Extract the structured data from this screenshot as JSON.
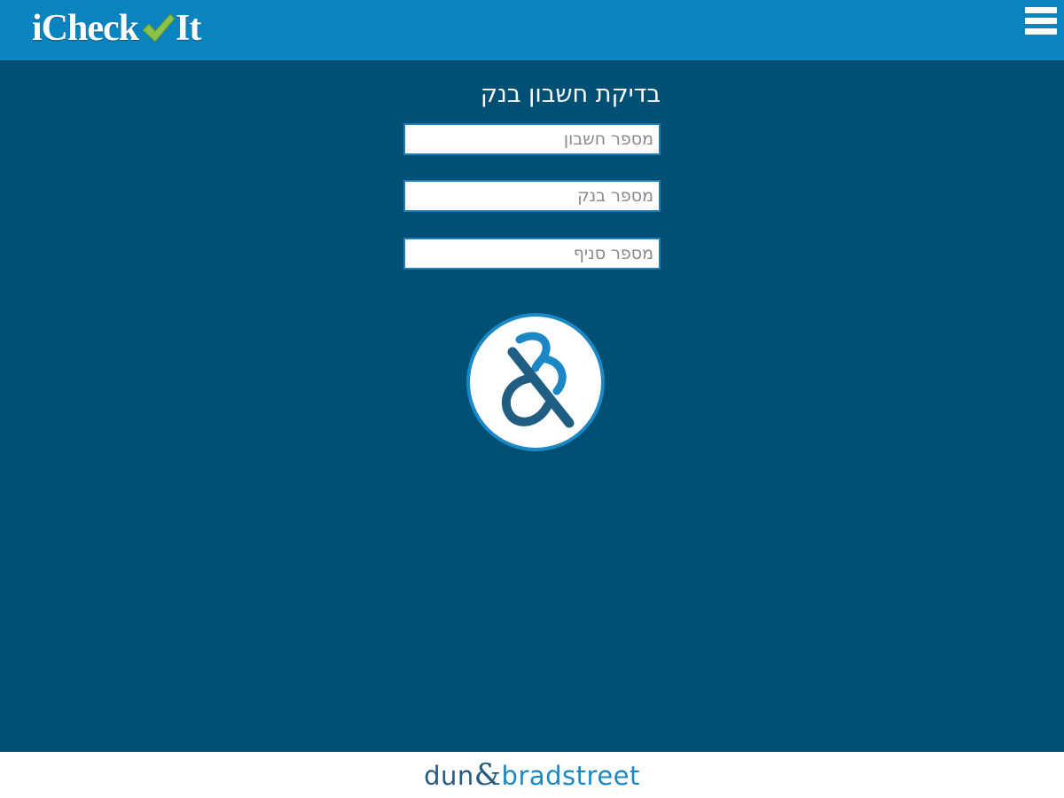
{
  "header": {
    "logo": {
      "part1": "iCheck",
      "icon": "checkmark-icon",
      "part2": "It"
    },
    "menu_icon": "hamburger-menu-icon"
  },
  "form": {
    "title": "בדיקת חשבון בנק",
    "fields": {
      "account_number": {
        "placeholder": "מספר חשבון",
        "value": ""
      },
      "bank_number": {
        "placeholder": "מספר בנק",
        "value": ""
      },
      "branch_number": {
        "placeholder": "מספר סניף",
        "value": ""
      }
    },
    "submit_icon": "ampersand-logo-icon"
  },
  "footer": {
    "brand_left": "dun",
    "brand_amp": "&",
    "brand_right": "bradstreet"
  },
  "colors": {
    "header_bg": "#0a84bf",
    "page_bg": "#004f74",
    "checkmark": "#8bc34a",
    "accent_blue": "#1b87c4",
    "dark_blue": "#255b80"
  }
}
